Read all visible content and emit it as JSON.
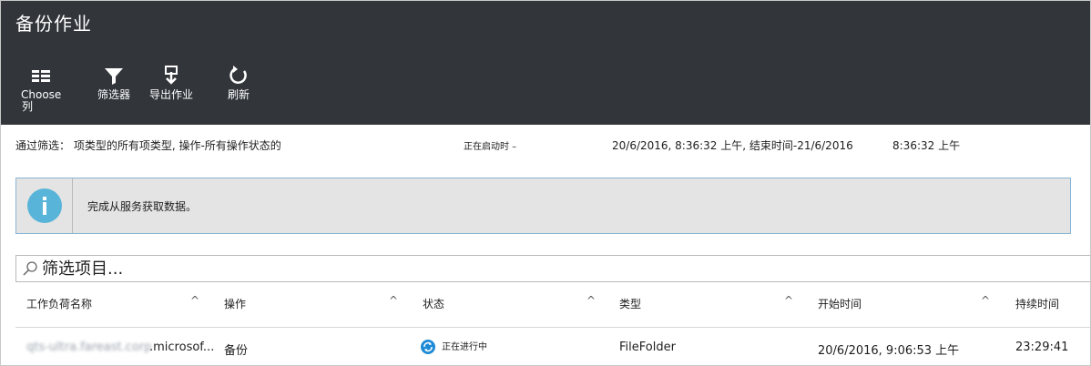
{
  "header": {
    "title": "备份作业"
  },
  "toolbar": {
    "choose_columns_line1": "Choose",
    "choose_columns_line2": "列",
    "filter": "筛选器",
    "export": "导出作业",
    "refresh": "刷新",
    "icons": [
      "columns-icon",
      "filter-icon",
      "export-icon",
      "refresh-icon"
    ]
  },
  "filter_summary": {
    "text": "通过筛选： 项类型的所有项类型, 操作-所有操作状态的",
    "start_label": "正在启动时 –",
    "range": "20/6/2016, 8:36:32 上午, 结束时间-21/6/2016",
    "end_time": "8:36:32 上午"
  },
  "info": {
    "message": "完成从服务获取数据。",
    "icon": "info-icon"
  },
  "search": {
    "placeholder": "筛选项目..."
  },
  "table": {
    "columns": [
      "工作负荷名称",
      "操作",
      "状态",
      "类型",
      "开始时间",
      "持续时间"
    ],
    "rows": [
      {
        "workload_blurred": "qts-ultra.fareast.corp",
        "workload_suffix": ".microsof...",
        "operation": "备份",
        "status": "正在进行中",
        "type": "FileFolder",
        "start_time": "20/6/2016, 9:06:53 上午",
        "duration": "23:29:41"
      }
    ]
  },
  "colors": {
    "header_bg": "#32363b",
    "info_bg": "#e4e4e4",
    "info_icon": "#59b4d9",
    "status_icon": "#1e8ad6"
  }
}
